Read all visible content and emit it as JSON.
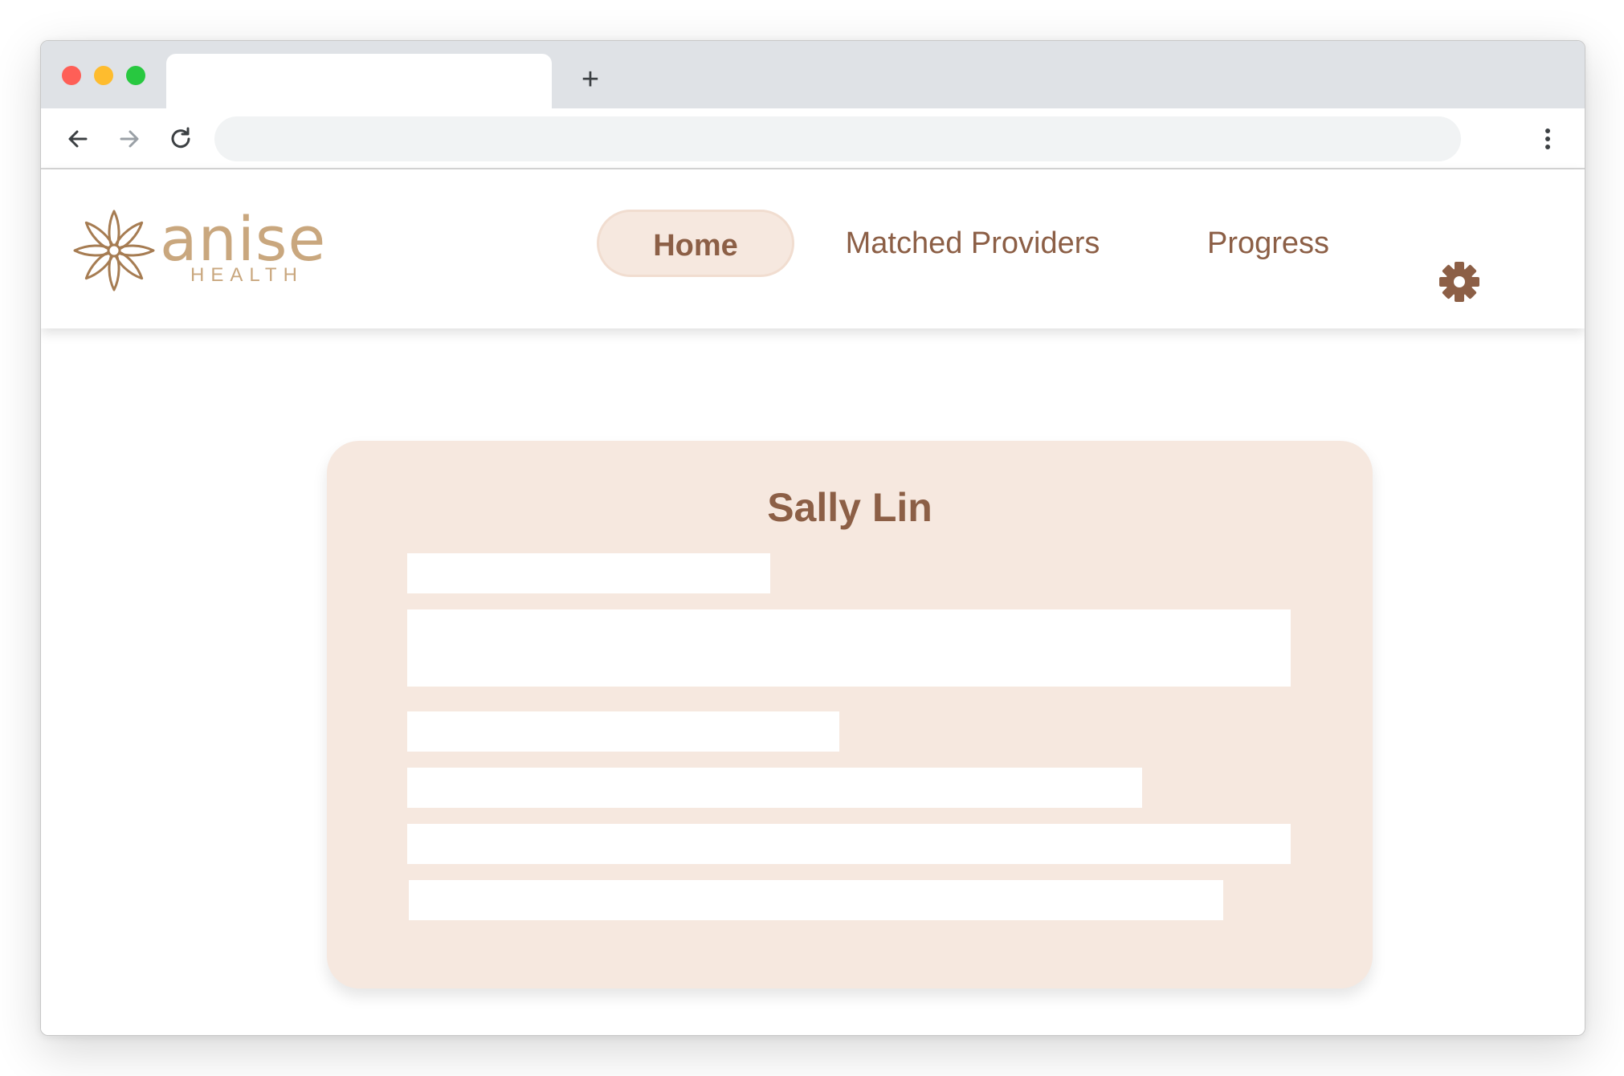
{
  "browser": {
    "active_tab_title": "",
    "new_tab_label": "+",
    "url": "",
    "icons": [
      "back-arrow-icon",
      "forward-arrow-icon",
      "reload-icon",
      "more-vertical-icon"
    ]
  },
  "header": {
    "brand": {
      "name": "anise",
      "subtitle": "HEALTH",
      "color": "#c9a77e"
    },
    "nav": {
      "home": "Home",
      "matched_providers": "Matched Providers",
      "progress": "Progress"
    },
    "settings_icon": "gear-icon",
    "active_item": "Home"
  },
  "profile_card": {
    "name": "Sally Lin",
    "placeholder_lines": 6
  },
  "colors": {
    "accent_text": "#8c5f46",
    "card_background": "#f6e8df",
    "logo": "#c9a77e"
  }
}
